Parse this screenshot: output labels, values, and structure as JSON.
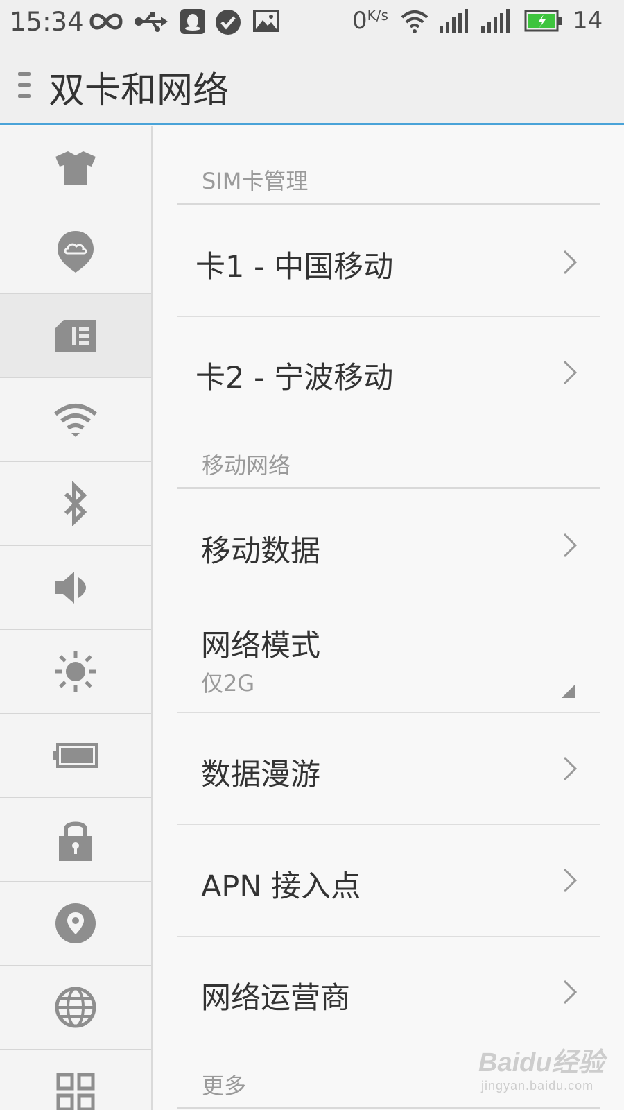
{
  "status_bar": {
    "time": "15:34",
    "speed_value": "0",
    "speed_unit": "K/s",
    "battery_level": "14",
    "icons": [
      "infinity-icon",
      "usb-icon",
      "qq-icon",
      "check-circle-icon",
      "image-icon",
      "wifi-icon",
      "signal-icon",
      "signal-icon",
      "battery-charging-icon"
    ]
  },
  "app_bar": {
    "title": "双卡和网络"
  },
  "sidebar": {
    "items": [
      {
        "icon": "theme-shirt-icon"
      },
      {
        "icon": "cloud-pin-icon"
      },
      {
        "icon": "sim-card-icon",
        "active": true
      },
      {
        "icon": "wifi-icon"
      },
      {
        "icon": "bluetooth-icon"
      },
      {
        "icon": "speaker-icon"
      },
      {
        "icon": "brightness-icon"
      },
      {
        "icon": "battery-icon"
      },
      {
        "icon": "lock-icon"
      },
      {
        "icon": "location-icon"
      },
      {
        "icon": "globe-icon"
      },
      {
        "icon": "apps-grid-icon"
      }
    ]
  },
  "main": {
    "sim_section": {
      "header": "SIM卡管理",
      "items": [
        {
          "label": "卡1 - 中国移动"
        },
        {
          "label": "卡2 - 宁波移动"
        }
      ]
    },
    "network_section": {
      "header": "移动网络",
      "items": [
        {
          "label": "移动数据"
        },
        {
          "label": "网络模式",
          "value": "仅2G"
        },
        {
          "label": "数据漫游"
        },
        {
          "label": "APN 接入点"
        },
        {
          "label": "网络运营商"
        }
      ]
    },
    "more_section": {
      "header": "更多"
    }
  },
  "watermark": {
    "brand": "Baidu经验",
    "url": "jingyan.baidu.com"
  },
  "colors": {
    "accent": "#4aa3d8",
    "icon_gray": "#8e8e8e",
    "battery_green": "#3ec43e"
  }
}
